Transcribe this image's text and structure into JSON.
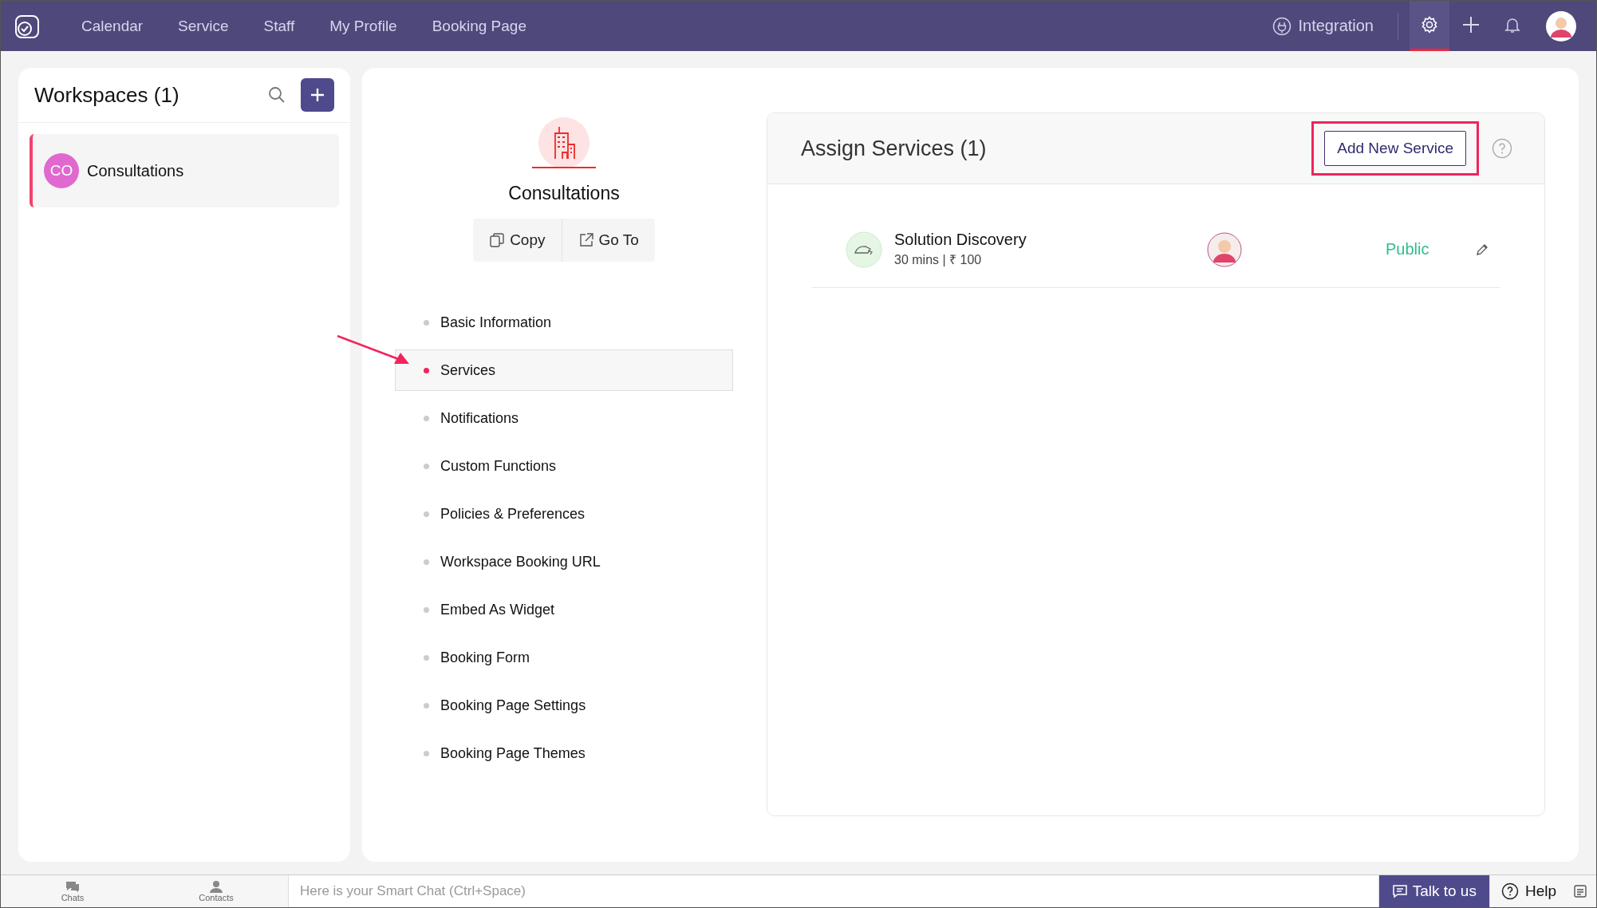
{
  "nav": {
    "items": [
      "Calendar",
      "Service",
      "Staff",
      "My Profile",
      "Booking Page"
    ],
    "integration": "Integration",
    "tools": [
      {
        "kind": "settings",
        "selected": true
      },
      {
        "kind": "plus",
        "selected": false
      },
      {
        "kind": "bell",
        "selected": false
      }
    ]
  },
  "workspaces": {
    "title": "Workspaces (1)",
    "items": [
      {
        "initials": "CO",
        "name": "Consultations",
        "selected": true,
        "color": "#e069cf"
      }
    ]
  },
  "detail": {
    "name": "Consultations",
    "actions": [
      {
        "kind": "copy",
        "label": "Copy"
      },
      {
        "kind": "goto",
        "label": "Go To"
      }
    ],
    "menu": [
      {
        "label": "Basic Information",
        "selected": false
      },
      {
        "label": "Services",
        "selected": true
      },
      {
        "label": "Notifications",
        "selected": false
      },
      {
        "label": "Custom Functions",
        "selected": false
      },
      {
        "label": "Policies & Preferences",
        "selected": false
      },
      {
        "label": "Workspace Booking URL",
        "selected": false
      },
      {
        "label": "Embed As Widget",
        "selected": false
      },
      {
        "label": "Booking Form",
        "selected": false
      },
      {
        "label": "Booking Page Settings",
        "selected": false
      },
      {
        "label": "Booking Page Themes",
        "selected": false
      }
    ]
  },
  "services_card": {
    "title": "Assign Services (1)",
    "add_button": "Add New Service",
    "highlighted": true,
    "rows": [
      {
        "name": "Solution Discovery",
        "meta": "30 mins | ₹ 100",
        "visibility": "Public"
      }
    ]
  },
  "bottom_bar": {
    "tabs": [
      "Chats",
      "Contacts"
    ],
    "chat_placeholder": "Here is your Smart Chat (Ctrl+Space)",
    "talk": "Talk to us",
    "help": "Help"
  }
}
